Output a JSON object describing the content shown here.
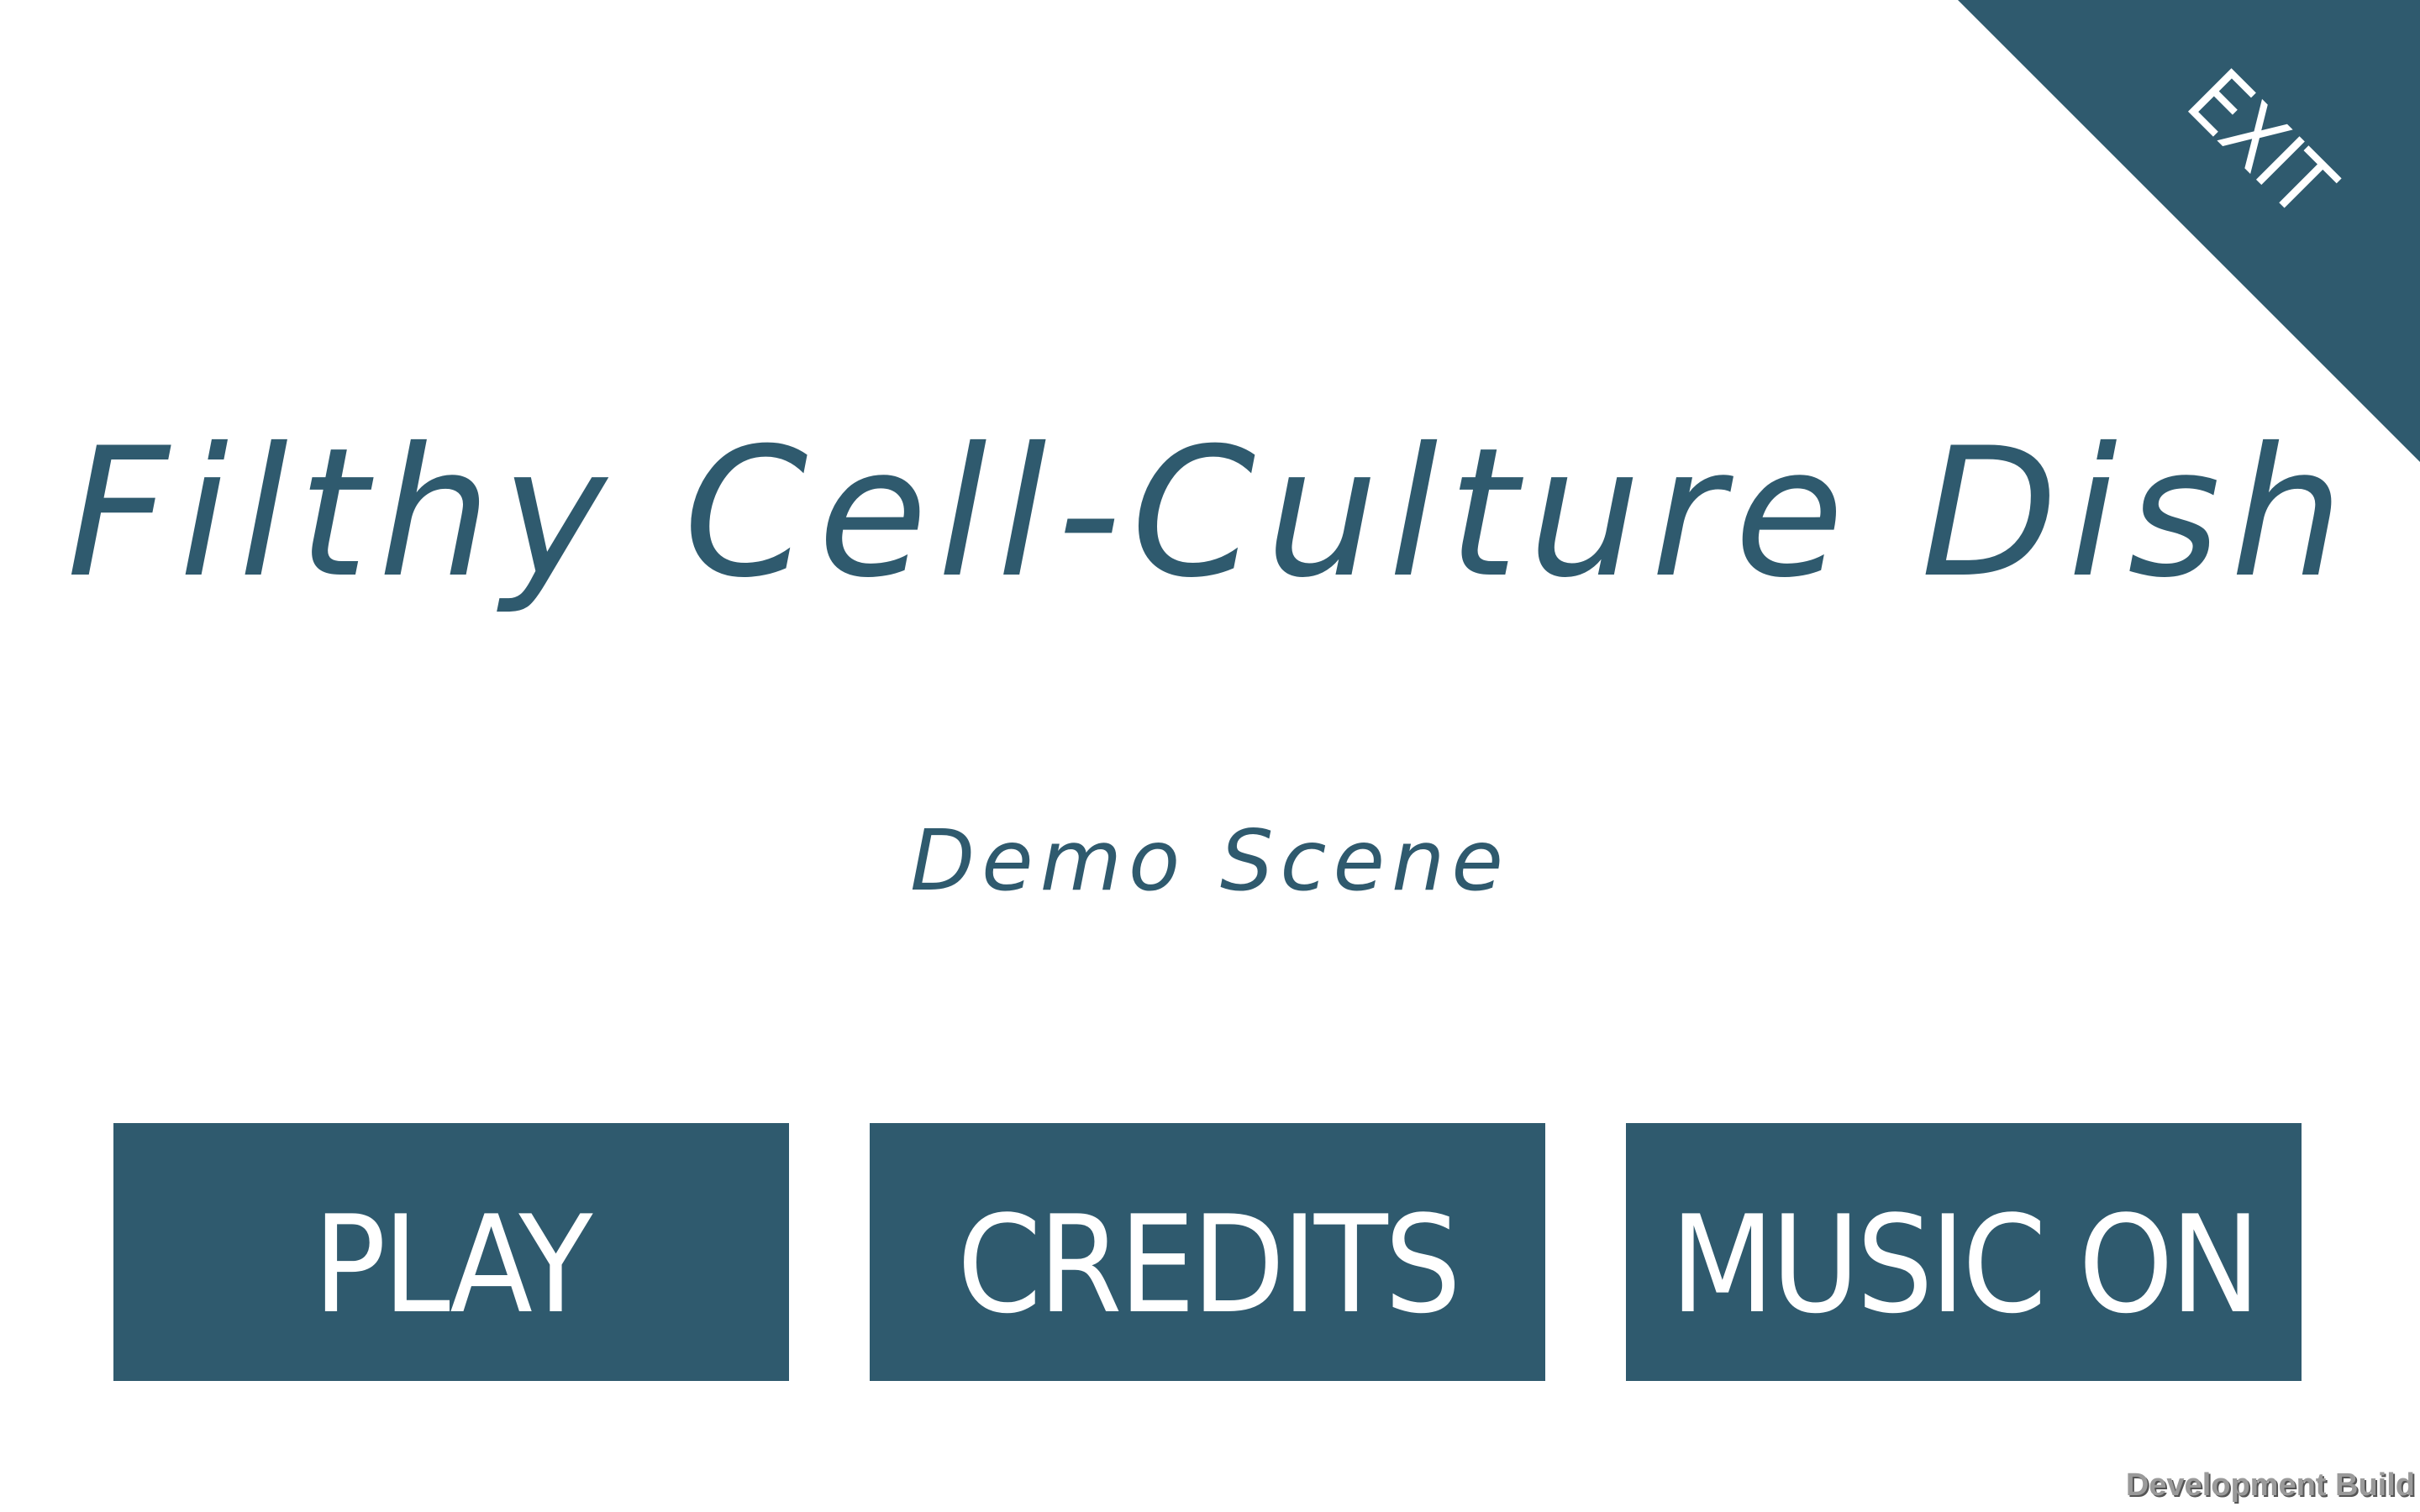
{
  "exit": {
    "label": "EXIT"
  },
  "title": "Filthy Cell-Culture Dish",
  "subtitle": "Demo Scene",
  "menu": {
    "play_label": "PLAY",
    "credits_label": "CREDITS",
    "music_label": "MUSIC ON"
  },
  "footer": {
    "build_label": "Development Build"
  },
  "colors": {
    "accent": "#2f5a6e",
    "background": "#ffffff",
    "button_text": "#ffffff"
  }
}
